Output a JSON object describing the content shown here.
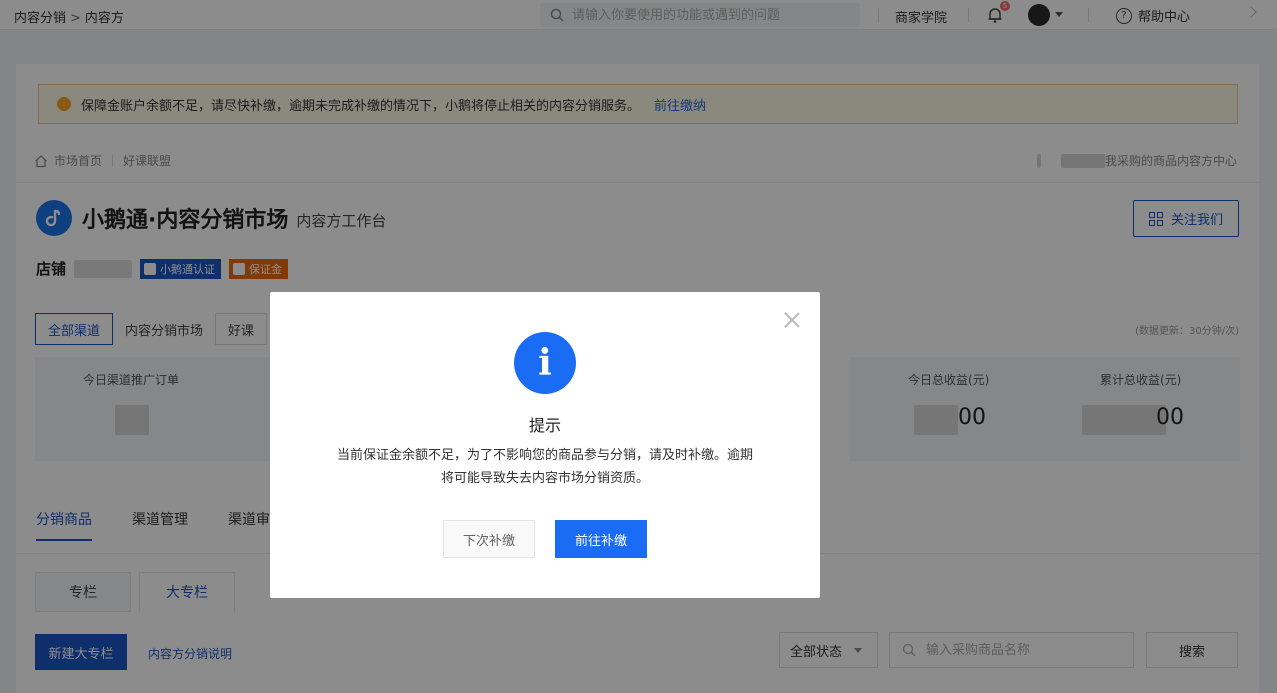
{
  "topbar": {
    "breadcrumb": [
      "内容分销",
      "内容方"
    ],
    "breadcrumb_sep": ">",
    "search_placeholder": "请输入你要使用的功能或遇到的问题",
    "school": "商家学院",
    "notify_count": "5",
    "help": "帮助中心"
  },
  "notice": {
    "text": "保障金账户余额不足，请尽快补缴，逾期未完成补缴的情况下，小鹅将停止相关的内容分销服务。",
    "link": "前往缴纳"
  },
  "subnav": {
    "left": [
      "市场首页",
      "好课联盟"
    ],
    "right": [
      "我采购的商品",
      "内容方中心"
    ]
  },
  "brand": {
    "title": "小鹅通·内容分销市场",
    "subtitle": "内容方工作台",
    "follow": "关注我们"
  },
  "shop": {
    "label": "店铺",
    "tag_cert": "小鹅通认证",
    "tag_deposit": "保证金"
  },
  "channels": {
    "tabs": [
      "全部渠道",
      "内容分销市场",
      "好课"
    ],
    "update_note": "(数据更新：30分钟/次)"
  },
  "stats": {
    "orders_label": "今日渠道推广订单",
    "today_income_label": "今日总收益(元)",
    "today_income_suffix": "00",
    "total_income_label": "累计总收益(元)",
    "total_income_suffix": "00"
  },
  "sections": {
    "tabs": [
      "分销商品",
      "渠道管理",
      "渠道审"
    ],
    "subtabs": [
      "专栏",
      "大专栏"
    ]
  },
  "toolbar": {
    "new": "新建大专栏",
    "explain": "内容方分销说明",
    "status": "全部状态",
    "search_placeholder": "输入采购商品名称",
    "search": "搜索"
  },
  "modal": {
    "title": "提示",
    "body_line1": "当前保证金余额不足，为了不影响您的商品参与分销，请及时补缴。逾期",
    "body_line2": "将可能导致失去内容市场分销资质。",
    "later": "下次补缴",
    "go": "前往补缴"
  },
  "colors": {
    "primary": "#1a56c4",
    "modal_primary": "#1a6cf5",
    "notice_bg": "#fef7e6",
    "notice_dot": "#f6a623",
    "deposit_tag": "#e86a17"
  }
}
